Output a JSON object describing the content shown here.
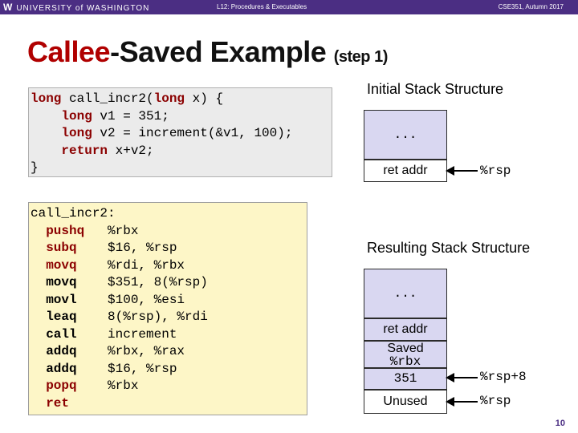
{
  "header": {
    "logo_initial": "W",
    "logo_text": "UNIVERSITY of WASHINGTON",
    "lecture": "L12: Procedures & Executables",
    "course": "CSE351, Autumn 2017"
  },
  "title": {
    "part1": "Callee",
    "part2": "-Saved Example",
    "step": "(step 1)"
  },
  "c_code": {
    "sig_kw": "long",
    "sig_rest": " call_incr2(",
    "param_kw": "long",
    "param_rest": " x) {",
    "l1_kw": "long",
    "l1_rest": " v1 = 351;",
    "l2_kw": "long",
    "l2_rest": " v2 = increment(&v1, 100);",
    "l3_kw": "return",
    "l3_rest": " x+v2;",
    "close": "}"
  },
  "asm": {
    "label": "call_incr2:",
    "lines": [
      {
        "op": "pushq",
        "args": "%rbx"
      },
      {
        "op": "subq",
        "args": "$16, %rsp"
      },
      {
        "op": "movq",
        "args": "%rdi, %rbx"
      },
      {
        "op": "movq",
        "args": "$351, 8(%rsp)"
      },
      {
        "op": "movl",
        "args": "$100, %esi"
      },
      {
        "op": "leaq",
        "args": "8(%rsp), %rdi"
      },
      {
        "op": "call",
        "args": "increment"
      },
      {
        "op": "addq",
        "args": "%rbx, %rax"
      },
      {
        "op": "addq",
        "args": "$16, %rsp"
      },
      {
        "op": "popq",
        "args": "%rbx"
      },
      {
        "op": "ret",
        "args": ""
      }
    ]
  },
  "initial_stack": {
    "heading": "Initial Stack Structure",
    "slots": [
      "...",
      "ret addr"
    ],
    "pointer": "%rsp"
  },
  "result_stack": {
    "heading": "Resulting Stack Structure",
    "slots": [
      "...",
      "ret addr",
      "Saved",
      "%rbx",
      "351",
      "Unused"
    ],
    "pointer_top": "%rsp+8",
    "pointer_bottom": "%rsp"
  },
  "page_number": "10",
  "colors": {
    "header_bg": "#4b2e83",
    "callee": "#b00000",
    "keyword": "#8b0000",
    "stack_fill": "#d9d7f1",
    "code_bg": "#ebebeb",
    "asm_bg": "#fdf6c7"
  }
}
